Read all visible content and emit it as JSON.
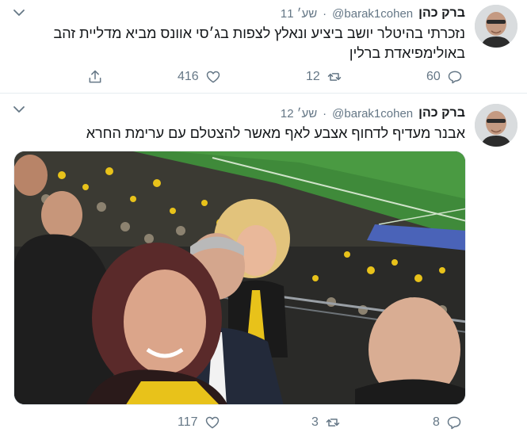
{
  "tweets": [
    {
      "author": {
        "name": "ברק כהן",
        "handle": "@barak1cohen"
      },
      "time": "11 שע׳",
      "separator": "·",
      "text": "נזכרתי בהיטלר יושב ביציע ונאלץ לצפות בג׳סי אוונס מביא מדליית זהב באולימפיאדת ברלין",
      "actions": {
        "replies": "60",
        "retweets": "12",
        "likes": "416"
      }
    },
    {
      "author": {
        "name": "ברק כהן",
        "handle": "@barak1cohen"
      },
      "time": "12 שע׳",
      "separator": "·",
      "text": "אבנר מעדיף לדחוף אצבע לאף מאשר להצטלם עם ערימת החרא",
      "actions": {
        "replies": "8",
        "retweets": "3",
        "likes": "117"
      }
    }
  ],
  "icons": {
    "reply": "reply-icon",
    "retweet": "retweet-icon",
    "like": "heart-icon",
    "share": "share-icon",
    "caret": "chevron-down-icon"
  },
  "colors": {
    "text": "#14171a",
    "secondary": "#657786",
    "divider": "#e6ecf0",
    "pitch": "#3f8a3a",
    "crowd_yellow": "#e8c21a"
  }
}
